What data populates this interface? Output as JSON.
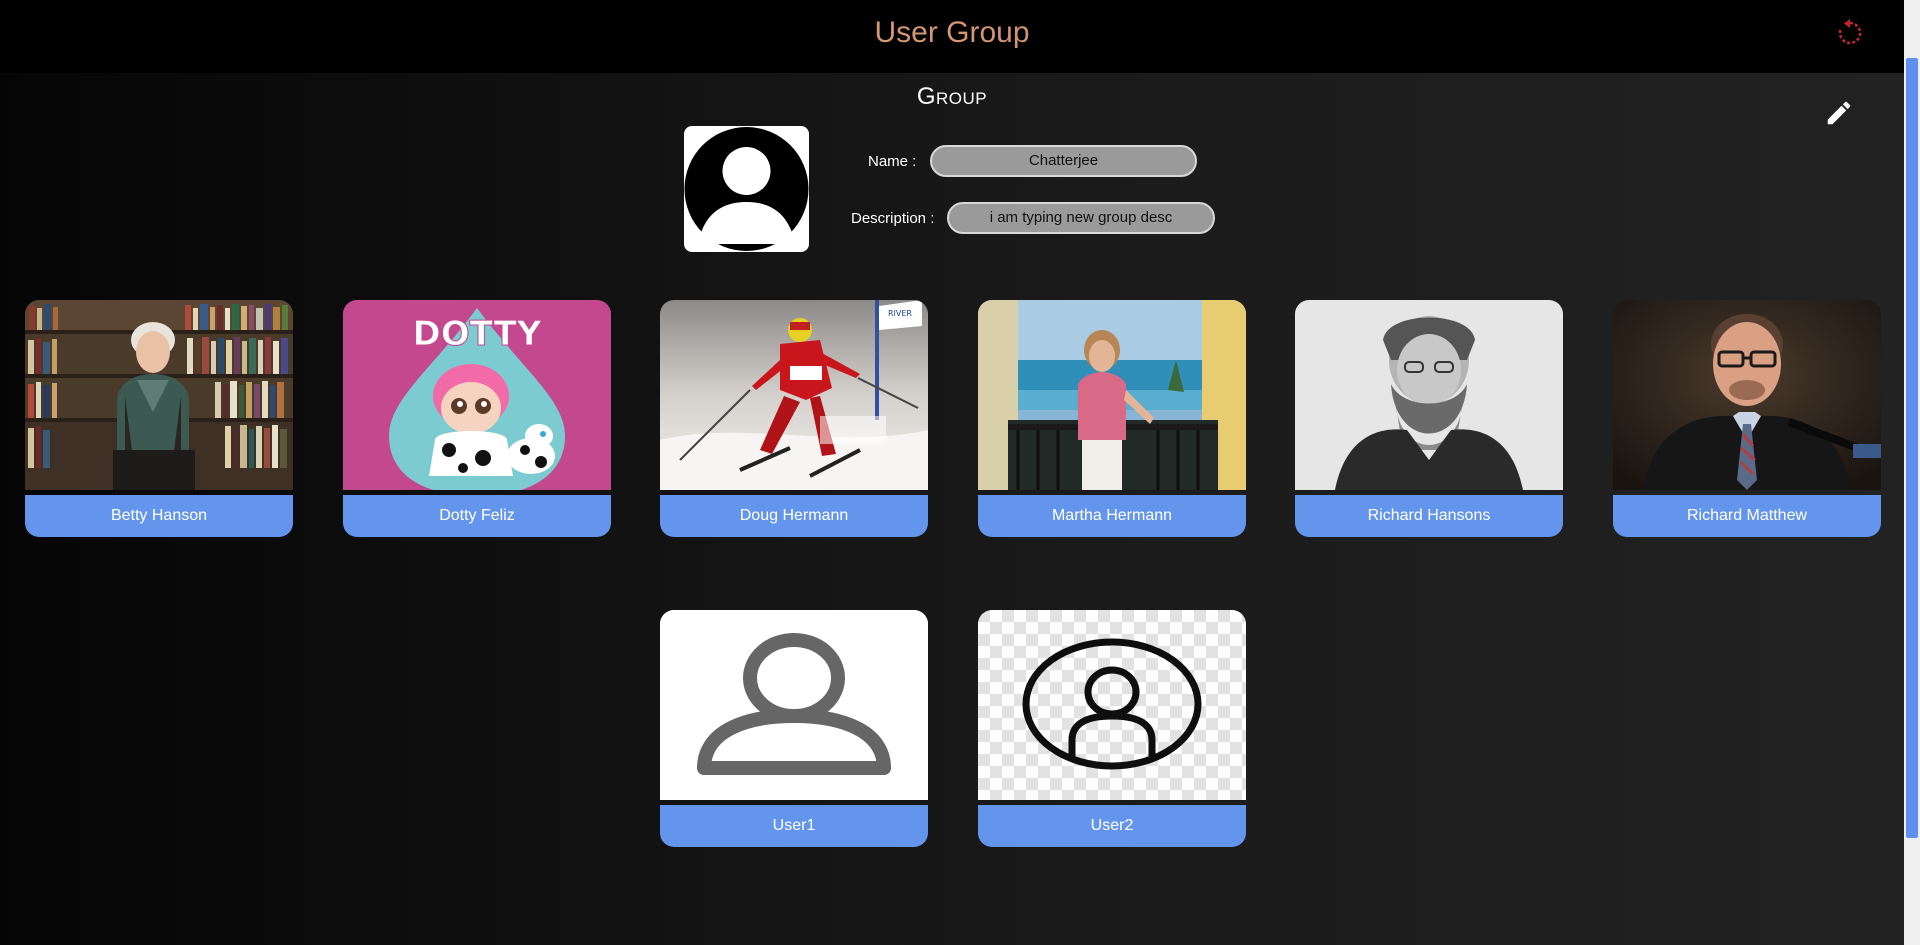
{
  "header": {
    "title": "User Group",
    "refresh_icon": "refresh-icon",
    "title_colors": [
      "#d6b06e",
      "#c86a7a"
    ]
  },
  "group": {
    "section_title": "Group",
    "edit_icon": "pencil-icon",
    "avatar_icon": "user-avatar-icon",
    "name_label": "Name :",
    "name_value": "Chatterjee",
    "description_label": "Description :",
    "description_value": "i am typing new group desc"
  },
  "members": [
    {
      "name": "Betty Hanson",
      "photo": "elderly woman in front of bookshelves"
    },
    {
      "name": "Dotty Feliz",
      "photo": "cartoon doll with DOTTY text"
    },
    {
      "name": "Doug Hermann",
      "photo": "slalom skier in snow"
    },
    {
      "name": "Martha Hermann",
      "photo": "woman on balcony by the sea"
    },
    {
      "name": "Richard Hansons",
      "photo": "black and white portrait of bearded man"
    },
    {
      "name": "Richard Matthew",
      "photo": "man speaking at microphone"
    },
    {
      "name": "User1",
      "photo": "default user silhouette"
    },
    {
      "name": "User2",
      "photo": "default user circle icon"
    }
  ],
  "theme": {
    "accent": "#6495ed",
    "refresh_color": "#c0272d",
    "pill_bg": "#9a9a9a"
  }
}
